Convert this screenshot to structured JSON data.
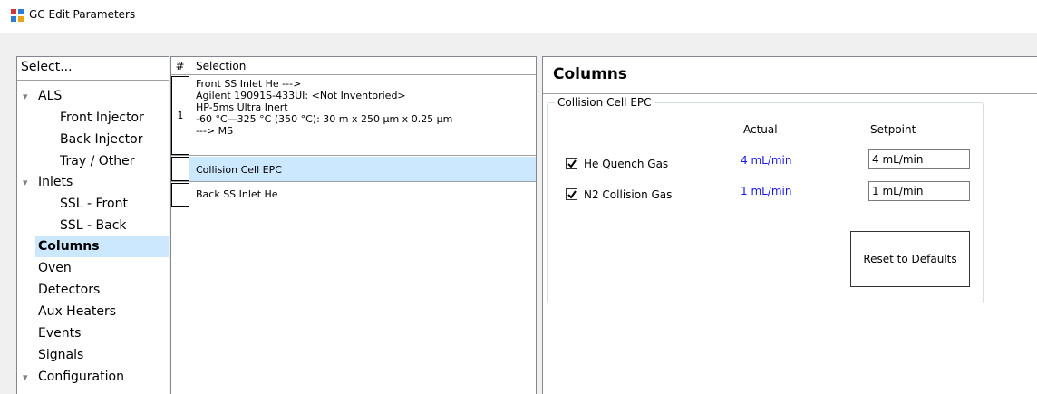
{
  "window": {
    "title": "GC Edit Parameters"
  },
  "nav": {
    "header": "Select...",
    "items": [
      {
        "label": "ALS",
        "level": 0,
        "expand": "▾"
      },
      {
        "label": "Front Injector",
        "level": 2
      },
      {
        "label": "Back Injector",
        "level": 2
      },
      {
        "label": "Tray / Other",
        "level": 2
      },
      {
        "label": "Inlets",
        "level": 0,
        "expand": "▾"
      },
      {
        "label": "SSL - Front",
        "level": 1
      },
      {
        "label": "SSL - Back",
        "level": 1
      },
      {
        "label": "Columns",
        "level": 0,
        "selected": true
      },
      {
        "label": "Oven",
        "level": 0
      },
      {
        "label": "Detectors",
        "level": 0
      },
      {
        "label": "Aux Heaters",
        "level": 0
      },
      {
        "label": "Events",
        "level": 0
      },
      {
        "label": "Signals",
        "level": 0
      },
      {
        "label": "Configuration",
        "level": 0,
        "expand": "▾"
      }
    ]
  },
  "grid": {
    "col_num": "#",
    "col_selection": "Selection",
    "rows": [
      {
        "num": "1",
        "lines": [
          "Front SS Inlet He --->",
          "Agilent 19091S-433UI:  <Not Inventoried>",
          "HP-5ms Ultra Inert",
          "-60 °C—325 °C (350 °C): 30 m x 250 μm x 0.25 μm",
          "---> MS"
        ]
      },
      {
        "num": "",
        "lines": [
          "Collision Cell EPC"
        ],
        "selected": true
      },
      {
        "num": "",
        "lines": [
          "Back SS Inlet He"
        ]
      }
    ]
  },
  "details": {
    "title": "Columns",
    "group_title": "Collision Cell EPC",
    "col_actual": "Actual",
    "col_setpoint": "Setpoint",
    "gases": [
      {
        "label": "He Quench Gas",
        "checked": true,
        "actual": "4 mL/min",
        "setpoint": "4 mL/min"
      },
      {
        "label": "N2 Collision Gas",
        "checked": true,
        "actual": "1 mL/min",
        "setpoint": "1 mL/min"
      }
    ],
    "reset_label": "Reset to Defaults"
  },
  "colors": {
    "selection_bg": "#cce8ff",
    "actual_text": "#1a1ae6"
  }
}
